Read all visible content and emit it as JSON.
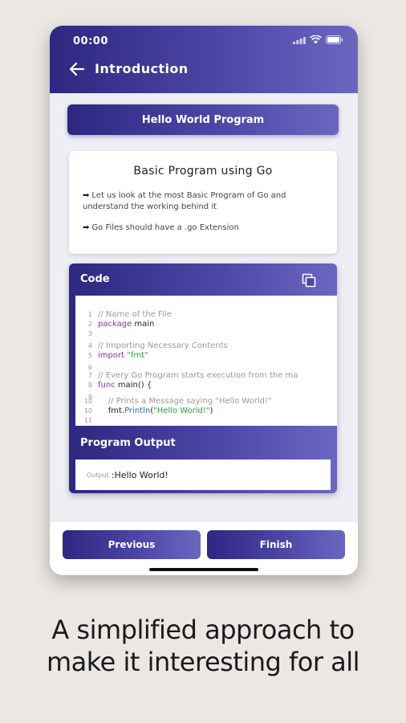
{
  "status_bar": {
    "time": "00:00"
  },
  "app_bar": {
    "title": "Introduction"
  },
  "topic": {
    "label": "Hello World Program"
  },
  "info": {
    "title": "Basic Program using Go",
    "points": [
      "Let us look at the most Basic Program of Go and understand the working behind it",
      "Go Files should have a .go Extension"
    ],
    "bullet": "➡"
  },
  "code_card": {
    "header": "Code",
    "lines": [
      {
        "n": "1",
        "parts": [
          {
            "t": "// Name of the File",
            "k": "comment"
          }
        ]
      },
      {
        "n": "2",
        "parts": [
          {
            "t": "package",
            "k": "kw"
          },
          {
            "t": " main",
            "k": "plain"
          }
        ]
      },
      {
        "n": "3",
        "parts": []
      },
      {
        "n": "4",
        "parts": [
          {
            "t": "// Importing Necessary Contents",
            "k": "comment"
          }
        ]
      },
      {
        "n": "5",
        "parts": [
          {
            "t": "import",
            "k": "kw"
          },
          {
            "t": " ",
            "k": "plain"
          },
          {
            "t": "\"fmt\"",
            "k": "str"
          }
        ]
      },
      {
        "n": "6",
        "parts": []
      },
      {
        "n": "7",
        "parts": [
          {
            "t": "// Every Go Program starts execution from the ma",
            "k": "comment"
          }
        ]
      },
      {
        "n": "8",
        "parts": [
          {
            "t": "func",
            "k": "kw"
          },
          {
            "t": " main() {",
            "k": "plain"
          }
        ]
      },
      {
        "n": "9",
        "parts": []
      },
      {
        "n": "10",
        "parts": [
          {
            "t": "    // Prints a Message saying \"Hello World!\"",
            "k": "comment"
          }
        ]
      },
      {
        "n": "10",
        "parts": [
          {
            "t": "    fmt.",
            "k": "plain"
          },
          {
            "t": "Println",
            "k": "fn"
          },
          {
            "t": "(",
            "k": "plain"
          },
          {
            "t": "\"Hello World!\"",
            "k": "str"
          },
          {
            "t": ")",
            "k": "plain"
          }
        ]
      },
      {
        "n": "11",
        "parts": []
      }
    ]
  },
  "output_card": {
    "header": "Program Output",
    "label": "Output",
    "value": ":Hello World!"
  },
  "nav": {
    "previous": "Previous",
    "finish": "Finish"
  },
  "caption": {
    "line1": "A simplified approach to",
    "line2": "make it interesting for all"
  },
  "colors": {
    "primary_dark": "#2e2780",
    "primary_light": "#6b67c0",
    "background": "#ebe8e4"
  }
}
